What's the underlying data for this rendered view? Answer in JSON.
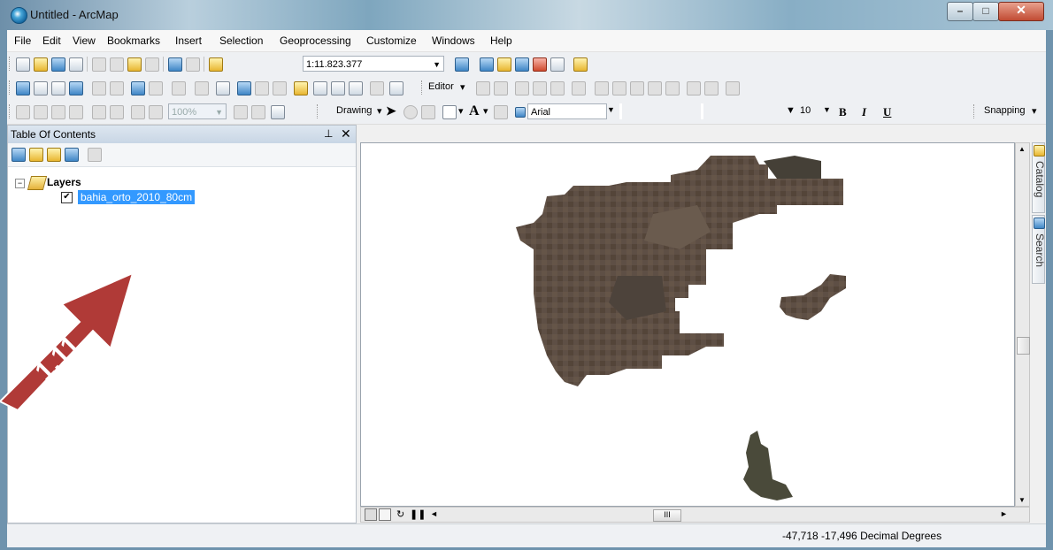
{
  "window": {
    "title": "Untitled - ArcMap",
    "app_icon": "arcmap-globe-icon"
  },
  "menubar": [
    "File",
    "Edit",
    "View",
    "Bookmarks",
    "Insert",
    "Selection",
    "Geoprocessing",
    "Customize",
    "Windows",
    "Help"
  ],
  "toolbar_standard": {
    "scale_value": "1:11.823.377"
  },
  "toolbar_editor": {
    "editor_label": "Editor"
  },
  "toolbar_layout": {
    "zoom_percent": "100%"
  },
  "toolbar_drawing": {
    "drawing_label": "Drawing",
    "font_name": "Arial",
    "font_size": "10",
    "bold": "B",
    "italic": "I",
    "underline": "U"
  },
  "toolbar_snapping": {
    "snapping_label": "Snapping"
  },
  "toc": {
    "title": "Table Of Contents",
    "root_label": "Layers",
    "layer_name": "bahia_orto_2010_80cm",
    "layer_checked": true
  },
  "annotation": {
    "label": "1.11",
    "color": "#b03a37"
  },
  "side_dock": {
    "catalog_label": "Catalog",
    "search_label": "Search"
  },
  "status": {
    "coordinates": "-47,718  -17,496 Decimal Degrees"
  },
  "colors": {
    "selection": "#3399ff",
    "raster": "#5e4f45"
  }
}
